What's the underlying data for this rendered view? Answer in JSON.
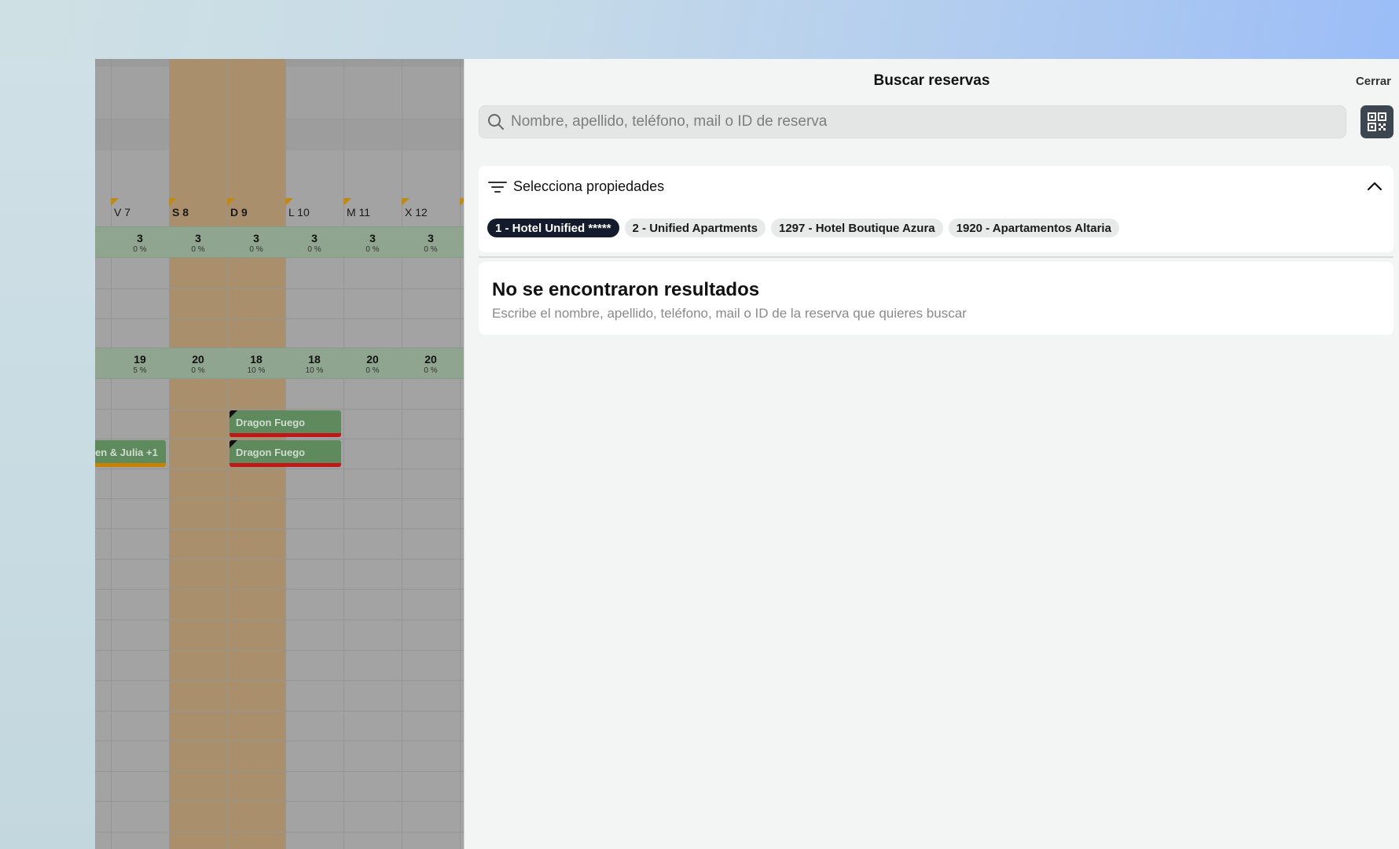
{
  "calendar": {
    "days": [
      {
        "label": "",
        "weekend": false
      },
      {
        "label": "V 7",
        "weekend": false
      },
      {
        "label": "S 8",
        "weekend": true
      },
      {
        "label": "D 9",
        "weekend": true
      },
      {
        "label": "L 10",
        "weekend": false
      },
      {
        "label": "M 11",
        "weekend": false
      },
      {
        "label": "X 12",
        "weekend": false
      }
    ],
    "occupancy_row_1": [
      {
        "n": "3",
        "p": "0 %"
      },
      {
        "n": "3",
        "p": "0 %"
      },
      {
        "n": "3",
        "p": "0 %"
      },
      {
        "n": "3",
        "p": "0 %"
      },
      {
        "n": "3",
        "p": "0 %"
      },
      {
        "n": "3",
        "p": "0 %"
      }
    ],
    "occupancy_row_2": [
      {
        "n": "19",
        "p": "5 %"
      },
      {
        "n": "20",
        "p": "0 %"
      },
      {
        "n": "18",
        "p": "10 %"
      },
      {
        "n": "18",
        "p": "10 %"
      },
      {
        "n": "20",
        "p": "0 %"
      },
      {
        "n": "20",
        "p": "0 %"
      }
    ],
    "bookings": [
      {
        "label": "Dragon Fuego"
      },
      {
        "label": "en & Julia +1"
      },
      {
        "label": "Dragon Fuego"
      }
    ]
  },
  "panel": {
    "title": "Buscar reservas",
    "close_label": "Cerrar",
    "search": {
      "placeholder": "Nombre, apellido, teléfono, mail o ID de reserva",
      "value": ""
    },
    "filter": {
      "label": "Selecciona propiedades",
      "properties": [
        {
          "label": "1 - Hotel Unified *****",
          "selected": true
        },
        {
          "label": "2 - Unified Apartments",
          "selected": false
        },
        {
          "label": "1297 - Hotel Boutique Azura",
          "selected": false
        },
        {
          "label": "1920 - Apartamentos Altaria",
          "selected": false
        }
      ]
    },
    "result": {
      "title": "No se encontraron resultados",
      "subtitle": "Escribe el nombre, apellido, teléfono, mail o ID de la reserva que quieres buscar"
    }
  },
  "colors": {
    "chip_active_bg": "#131b2c",
    "qr_button_bg": "#3b4650",
    "booking_green": "#5e8a5e",
    "booking_red": "#c01818"
  }
}
